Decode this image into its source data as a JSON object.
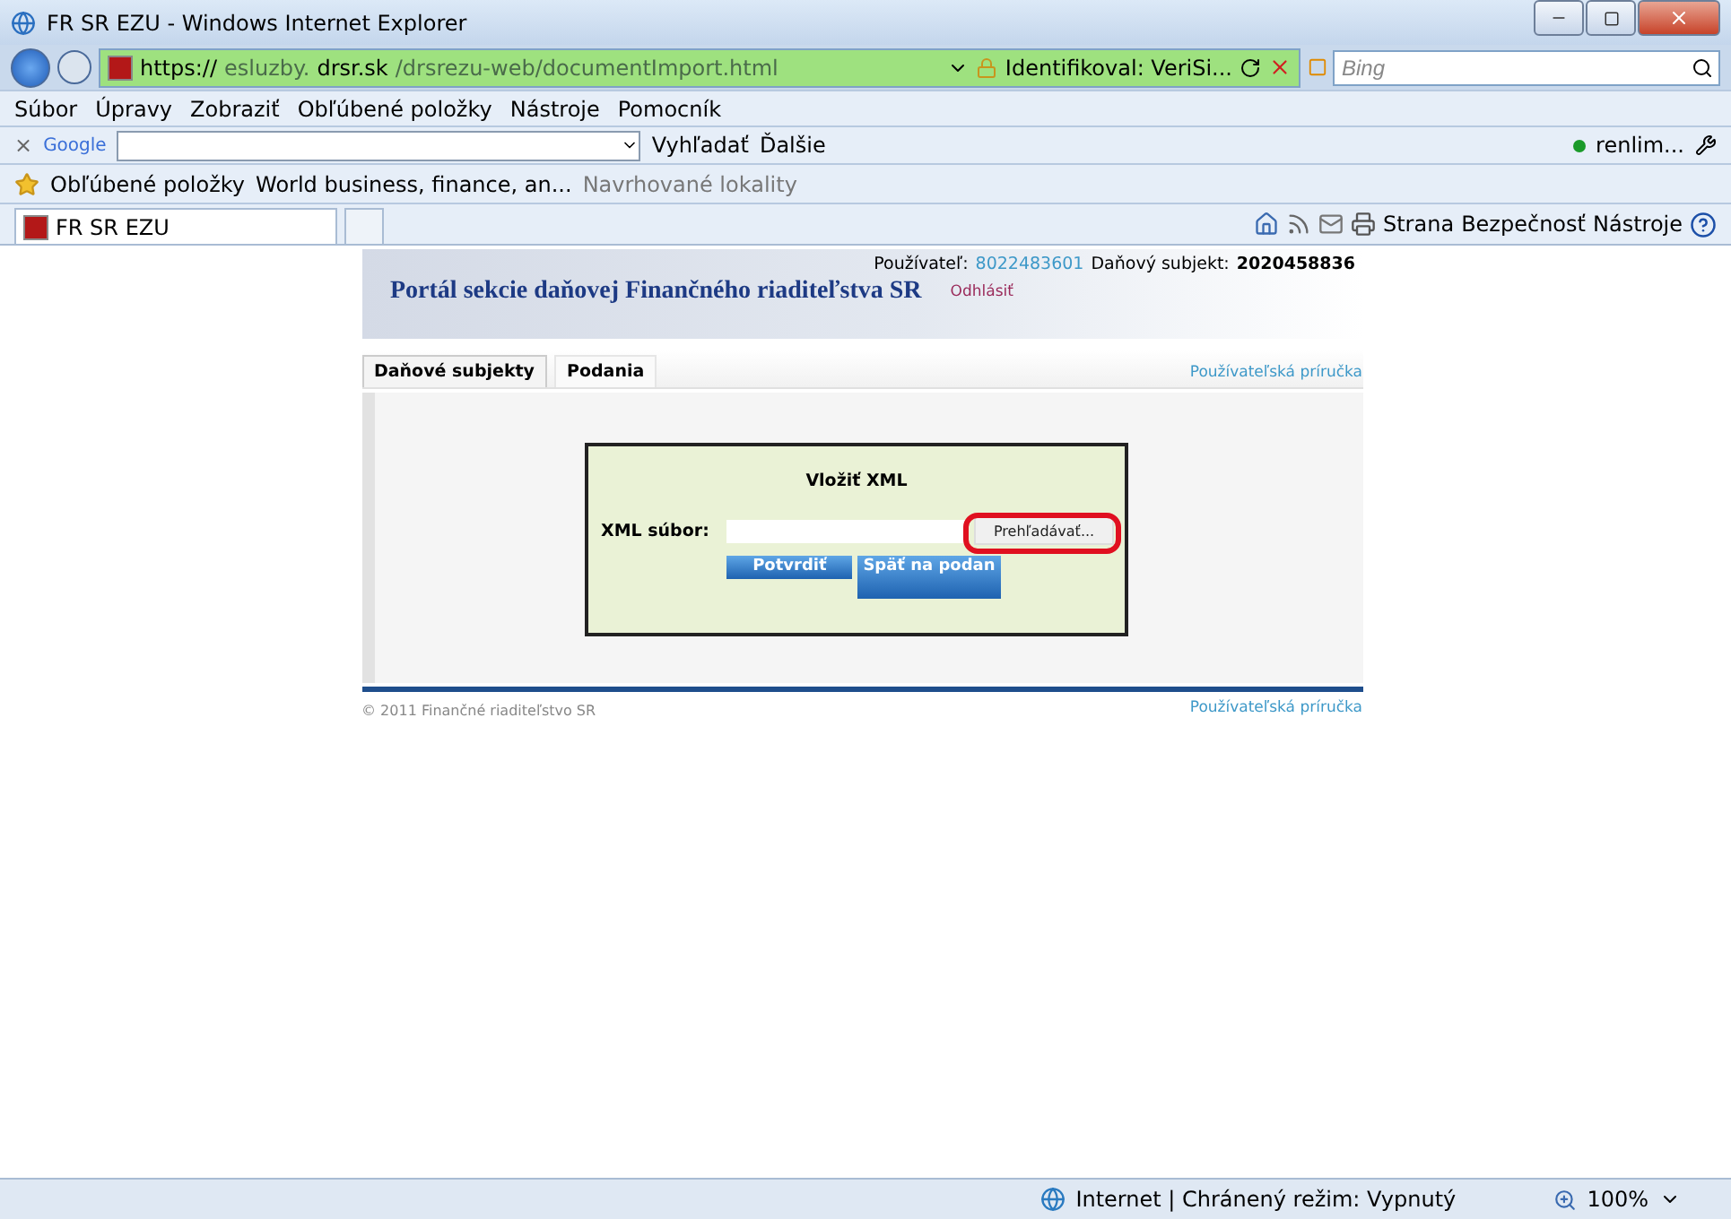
{
  "window": {
    "title": "FR SR EZU - Windows Internet Explorer"
  },
  "address_bar": {
    "url_parts": [
      {
        "text": "https://",
        "strong": true
      },
      {
        "text": "esluzby.",
        "strong": false
      },
      {
        "text": "drsr.sk",
        "strong": true
      },
      {
        "text": "/drsrezu-web/documentImport.html",
        "strong": false
      }
    ],
    "certificate": "Identifikoval: VeriSi...",
    "search_placeholder": "Bing"
  },
  "menu": [
    "Súbor",
    "Úpravy",
    "Zobraziť",
    "Obľúbené položky",
    "Nástroje",
    "Pomocník"
  ],
  "google_toolbar": {
    "close": "×",
    "logo": "Google",
    "search_button": "Vyhľadať",
    "more": "Ďalšie",
    "user": "renlim..."
  },
  "favorites_bar": {
    "favorites": "Obľúbené položky",
    "links": [
      {
        "label": "World business, finance, an...",
        "muted": false
      },
      {
        "label": "Navrhované lokality",
        "muted": true
      }
    ]
  },
  "tabs": [
    {
      "label": "FR SR EZU",
      "selected": true
    }
  ],
  "command_bar": [
    "Strana",
    "Bezpečnosť",
    "Nástroje"
  ],
  "page": {
    "header": {
      "title": "Portál sekcie daňovej Finančného riaditeľstva SR",
      "user_label": "Používateľ:",
      "user_id": "8022483601",
      "subject_label": "Daňový subjekt:",
      "subject_id": "2020458836",
      "logout": "Odhlásiť"
    },
    "nav": [
      {
        "label": "Daňové subjekty",
        "selected": true
      },
      {
        "label": "Podania",
        "selected": false
      }
    ],
    "guide_link": "Používateľská príručka",
    "form": {
      "title": "Vložiť XML",
      "field_label": "XML súbor:",
      "browse": "Prehľadávať...",
      "highlighted": true,
      "buttons": [
        "Potvrdiť",
        "Späť na podan"
      ]
    },
    "footer": {
      "copyright": "© 2011 Finančné riaditeľstvo SR",
      "guide_link": "Používateľská príručka"
    }
  },
  "status_bar": {
    "zone": "Internet | Chránený režim: Vypnutý",
    "zoom": "100%"
  }
}
